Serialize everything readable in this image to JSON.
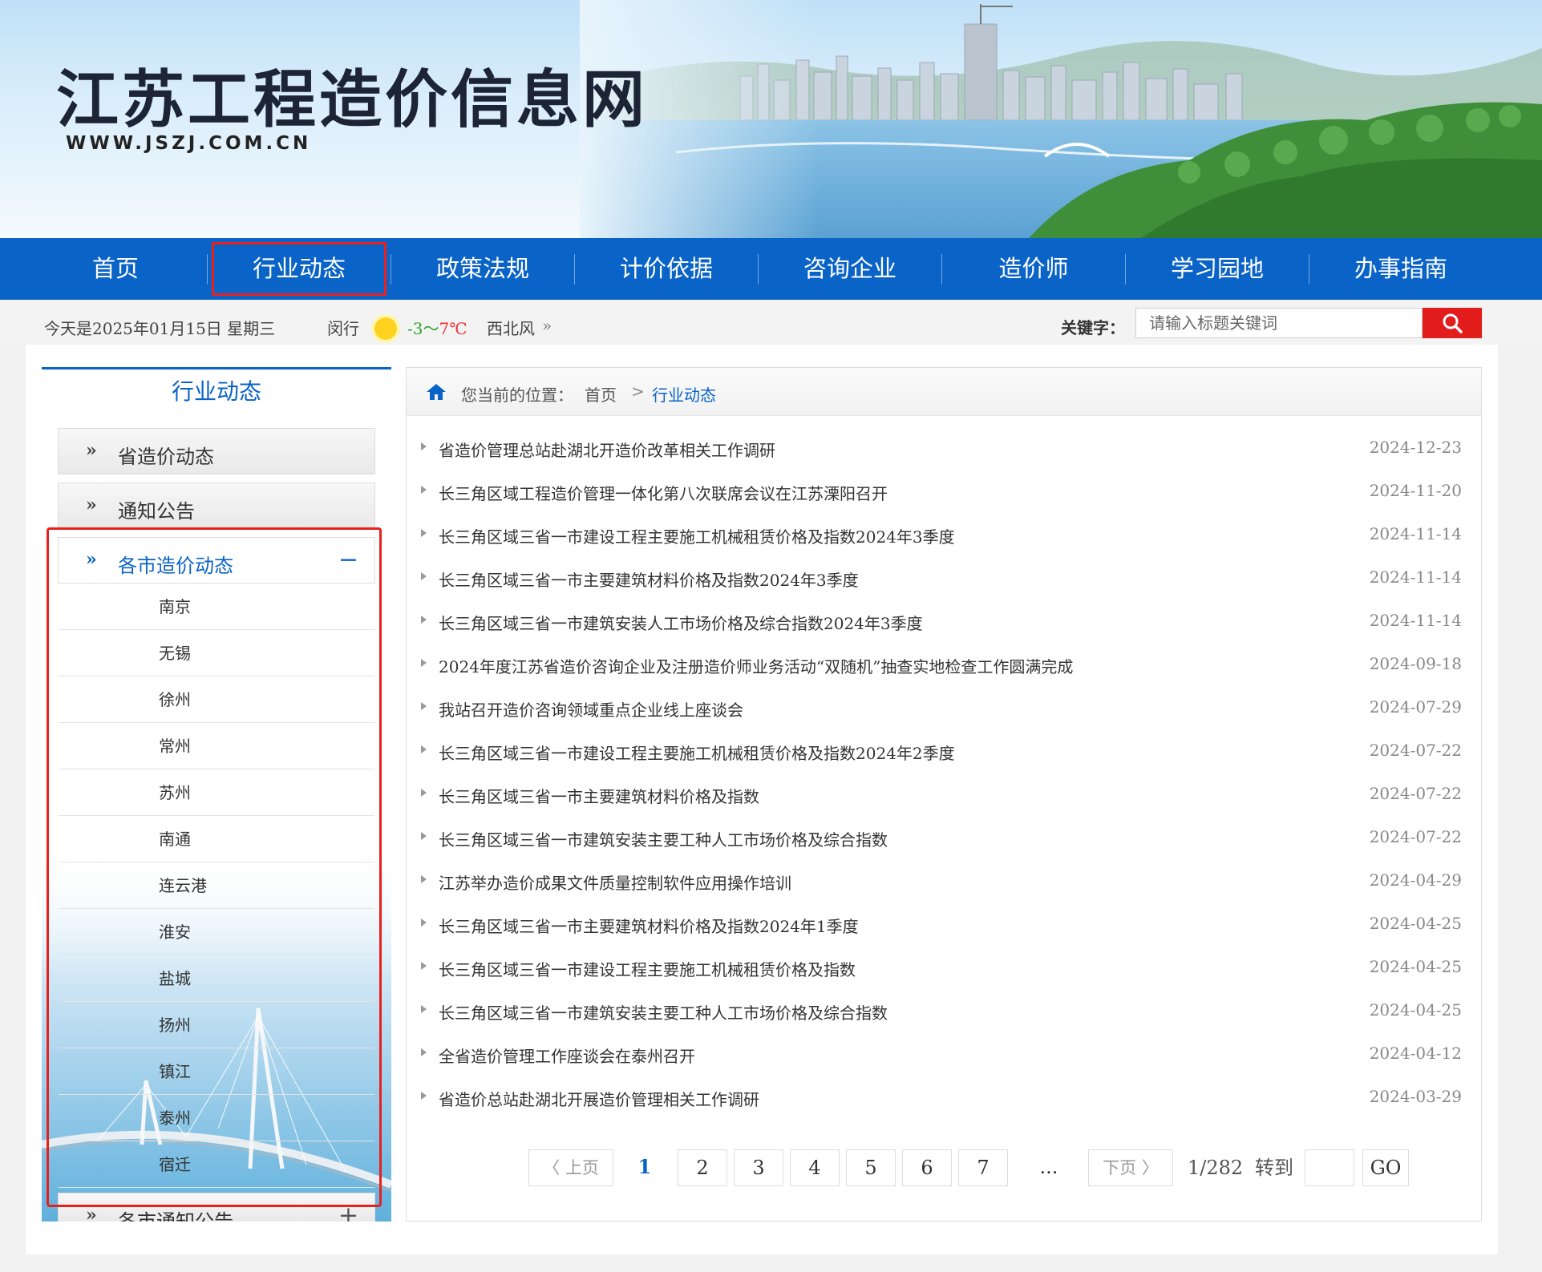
{
  "site": {
    "title": "江苏工程造价信息网",
    "url": "WWW.JSZJ.COM.CN"
  },
  "nav": [
    "首页",
    "行业动态",
    "政策法规",
    "计价依据",
    "咨询企业",
    "造价师",
    "学习园地",
    "办事指南"
  ],
  "infobar": {
    "date": "今天是2025年01月15日  星期三",
    "city": "闵行",
    "temp_low": "-3",
    "temp_sep": "～",
    "temp_high": "7℃",
    "wind": "西北风",
    "wind_arrow": "»",
    "keyword_label": "关键字：",
    "search_placeholder": "请输入标题关键词"
  },
  "sidebar": {
    "title": "行业动态",
    "categories": [
      {
        "label": "省造价动态",
        "arrow": "»"
      },
      {
        "label": "通知公告",
        "arrow": "»"
      },
      {
        "label": "各市造价动态",
        "arrow": "»",
        "sign": "−"
      },
      {
        "label": "各市通知公告",
        "arrow": "»",
        "sign": "+"
      }
    ],
    "cities": [
      "南京",
      "无锡",
      "徐州",
      "常州",
      "苏州",
      "南通",
      "连云港",
      "淮安",
      "盐城",
      "扬州",
      "镇江",
      "泰州",
      "宿迁"
    ]
  },
  "breadcrumb": {
    "label": "您当前的位置：",
    "home": "首页",
    "sep": ">",
    "current": "行业动态"
  },
  "news": [
    {
      "title": "省造价管理总站赴湖北开造价改革相关工作调研",
      "date": "2024-12-23"
    },
    {
      "title": "长三角区域工程造价管理一体化第八次联席会议在江苏溧阳召开",
      "date": "2024-11-20"
    },
    {
      "title": "长三角区域三省一市建设工程主要施工机械租赁价格及指数2024年3季度",
      "date": "2024-11-14"
    },
    {
      "title": "长三角区域三省一市主要建筑材料价格及指数2024年3季度",
      "date": "2024-11-14"
    },
    {
      "title": "长三角区域三省一市建筑安装人工市场价格及综合指数2024年3季度",
      "date": "2024-11-14"
    },
    {
      "title": "2024年度江苏省造价咨询企业及注册造价师业务活动“双随机”抽查实地检查工作圆满完成",
      "date": "2024-09-18"
    },
    {
      "title": "我站召开造价咨询领域重点企业线上座谈会",
      "date": "2024-07-29"
    },
    {
      "title": "长三角区域三省一市建设工程主要施工机械租赁价格及指数2024年2季度",
      "date": "2024-07-22"
    },
    {
      "title": "长三角区域三省一市主要建筑材料价格及指数",
      "date": "2024-07-22"
    },
    {
      "title": "长三角区域三省一市建筑安装主要工种人工市场价格及综合指数",
      "date": "2024-07-22"
    },
    {
      "title": "江苏举办造价成果文件质量控制软件应用操作培训",
      "date": "2024-04-29"
    },
    {
      "title": "长三角区域三省一市主要建筑材料价格及指数2024年1季度",
      "date": "2024-04-25"
    },
    {
      "title": "长三角区域三省一市建设工程主要施工机械租赁价格及指数",
      "date": "2024-04-25"
    },
    {
      "title": "长三角区域三省一市建筑安装主要工种人工市场价格及综合指数",
      "date": "2024-04-25"
    },
    {
      "title": "全省造价管理工作座谈会在泰州召开",
      "date": "2024-04-12"
    },
    {
      "title": "省造价总站赴湖北开展造价管理相关工作调研",
      "date": "2024-03-29"
    }
  ],
  "pagination": {
    "prev": "〈 上页",
    "pages": [
      "1",
      "2",
      "3",
      "4",
      "5",
      "6",
      "7"
    ],
    "dots": "...",
    "next": "下页 〉",
    "total": "1/282",
    "goto_label": "转到",
    "go": "GO"
  },
  "colors": {
    "brand_blue": "#0a63c6",
    "accent_red": "#e31c1c",
    "highlight_red": "#e8211e"
  }
}
